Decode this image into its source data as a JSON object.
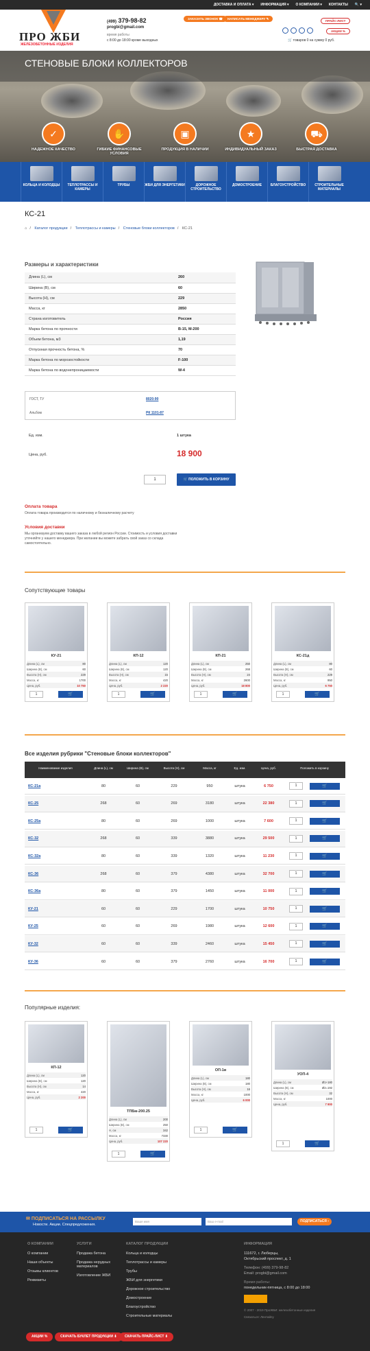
{
  "topnav": {
    "items": [
      "ДОСТАВКА И ОПЛАТА ▾",
      "ИНФОРМАЦИЯ ▾",
      "О КОМПАНИИ ▾",
      "КОНТАКТЫ",
      "🔍 ▾"
    ]
  },
  "header": {
    "logo_text": "ПРО ЖБИ",
    "logo_sub": "ЖЕЛЕЗОБЕТОННЫЕ ИЗДЕЛИЯ",
    "phone_prefix": "(499)",
    "phone": "379-98-82",
    "email": "progbi@gmail.com",
    "hours_label": "время работы",
    "hours": "с 8:00 до 18:00 кроме выходных",
    "btn_call": "ЗАКАЗАТЬ ЗВОНОК",
    "btn_manager": "НАПИСАТЬ МЕНЕДЖЕРУ",
    "btn_price": "ПРАЙС-ЛИСТ",
    "btn_stock": "АКЦИИ",
    "cart": "товаров 0 на сумму 0 руб."
  },
  "hero": {
    "title": "СТЕНОВЫЕ БЛОКИ КОЛЛЕКТОРОВ",
    "features": [
      "НАДЕЖНОЕ КАЧЕСТВО",
      "ГИБКИЕ ФИНАНСОВЫЕ УСЛОВИЯ",
      "ПРОДУКЦИЯ В НАЛИЧИИ",
      "ИНДИВИДУАЛЬНЫЙ ЗАКАЗ",
      "БЫСТРАЯ ДОСТАВКА"
    ]
  },
  "categories": [
    "КОЛЬЦА И КОЛОДЦЫ",
    "ТЕПЛОТРАССЫ И КАМЕРЫ",
    "ТРУБЫ",
    "ЖБИ ДЛЯ ЭНЕРГЕТИКИ",
    "ДОРОЖНОЕ СТРОИТЕЛЬСТВО",
    "ДОМОСТРОЕНИЕ",
    "БЛАГОУСТРОЙСТВО",
    "СТРОИТЕЛЬНЫЕ МАТЕРИАЛЫ"
  ],
  "product": {
    "title": "КС-21",
    "breadcrumbs": [
      "Каталог продукции",
      "Теплотрассы и камеры",
      "Стеновые блоки коллекторов",
      "КС-21"
    ],
    "specs_title": "Размеры и характеристики",
    "specs": [
      [
        "Длина (L), см",
        "260"
      ],
      [
        "Ширина (B), см",
        "60"
      ],
      [
        "Высота (H), см",
        "229"
      ],
      [
        "Масса, кг",
        "2850"
      ],
      [
        "Страна изготовитель",
        "Россия"
      ],
      [
        "Марка бетона по прочности",
        "В-15, М-200"
      ],
      [
        "Объем бетона, м3",
        "1,19"
      ],
      [
        "Отпускная прочность бетона, %",
        "70"
      ],
      [
        "Марка бетона по морозостойкости",
        "F-100"
      ],
      [
        "Марка бетона по водонепроницаемости",
        "W-4"
      ]
    ],
    "gost_label": "ГОСТ, ТУ",
    "gost_value": "8020-90",
    "album_label": "Альбом",
    "album_value": "РК 1101-87",
    "unit_label": "Ед. изм.",
    "unit_value": "1 штука",
    "price_label": "Цена, руб.",
    "price_value": "18 900",
    "qty": "1",
    "add_btn": "ПОЛОЖИТЬ В КОРЗИНУ"
  },
  "payment": {
    "title": "Оплата товара",
    "text": "Оплата товара производится по наличному и безналичному расчету",
    "delivery_title": "Условия доставки",
    "delivery_text1": "Мы организуем доставку вашего заказа в любой регион России. Стоимость и условия доставки",
    "delivery_text2": "уточняйте у нашего менеджера. При желании вы можете забрать свой заказ со склада",
    "delivery_text3": "самостоятельно."
  },
  "related": {
    "title": "Сопутствующие товары",
    "items": [
      {
        "name": "КУ-21",
        "rows": [
          [
            "Длина (L), см",
            "80"
          ],
          [
            "Ширина (B), см",
            "60"
          ],
          [
            "Высота (H), см",
            "229"
          ],
          [
            "Масса, кг",
            "1700"
          ],
          [
            "Цена, руб.",
            "10 750"
          ]
        ]
      },
      {
        "name": "КП-12",
        "rows": [
          [
            "Длина (L), см",
            "120"
          ],
          [
            "Ширина (B), см",
            "120"
          ],
          [
            "Высота (H), см",
            "15"
          ],
          [
            "Масса, кг",
            "420"
          ],
          [
            "Цена, руб.",
            "2 220"
          ]
        ]
      },
      {
        "name": "КП-21",
        "rows": [
          [
            "Длина (L), см",
            "250"
          ],
          [
            "Ширина (B), см",
            "268"
          ],
          [
            "Высота (H), см",
            "24"
          ],
          [
            "Масса, кг",
            "2600"
          ],
          [
            "Цена, руб.",
            "18 800"
          ]
        ]
      },
      {
        "name": "КС-21д",
        "rows": [
          [
            "Длина (L), см",
            "80"
          ],
          [
            "Ширина (B), см",
            "60"
          ],
          [
            "Высота (H), см",
            "229"
          ],
          [
            "Масса, кг",
            "950"
          ],
          [
            "Цена, руб.",
            "6 750"
          ]
        ]
      }
    ]
  },
  "list": {
    "title": "Все изделия рубрики \"Стеновые блоки коллекторов\"",
    "headers": [
      "Наименование изделия",
      "Длина (L), см",
      "Ширина (B), см",
      "Высота (H), см",
      "Масса, кг",
      "Ед. изм.",
      "Цена, руб.",
      "Положить в корзину"
    ],
    "rows": [
      [
        "КС-21а",
        "80",
        "60",
        "229",
        "950",
        "штука",
        "6 750"
      ],
      [
        "КС-25",
        "268",
        "60",
        "269",
        "3180",
        "штука",
        "22 380"
      ],
      [
        "КС-25а",
        "80",
        "60",
        "269",
        "1000",
        "штука",
        "7 600"
      ],
      [
        "КС-32",
        "268",
        "60",
        "339",
        "3880",
        "штука",
        "29 500"
      ],
      [
        "КС-32а",
        "80",
        "60",
        "339",
        "1320",
        "штука",
        "11 230"
      ],
      [
        "КС-36",
        "268",
        "60",
        "379",
        "4380",
        "штука",
        "32 700"
      ],
      [
        "КС-36а",
        "80",
        "60",
        "379",
        "1450",
        "штука",
        "11 000"
      ],
      [
        "КУ-21",
        "60",
        "60",
        "229",
        "1700",
        "штука",
        "10 750"
      ],
      [
        "КУ-25",
        "60",
        "60",
        "269",
        "1980",
        "штука",
        "12 600"
      ],
      [
        "КУ-32",
        "60",
        "60",
        "339",
        "2460",
        "штука",
        "15 450"
      ],
      [
        "КУ-36",
        "60",
        "60",
        "379",
        "2760",
        "штука",
        "16 700"
      ]
    ],
    "qty": "1"
  },
  "popular": {
    "title": "Популярные изделия:",
    "items": [
      {
        "name": "КП-12",
        "rows": [
          [
            "Длина (L), см",
            "120"
          ],
          [
            "Ширина (B), см",
            "120"
          ],
          [
            "Высота (H), см",
            "14"
          ],
          [
            "Масса, кг",
            "420"
          ],
          [
            "Цена, руб.",
            "2 200"
          ]
        ]
      },
      {
        "name": "ТПБм-200.25",
        "rows": [
          [
            "Длина (L), см",
            "200"
          ],
          [
            "Ширина (B), см",
            "250"
          ],
          [
            "H, см",
            "342"
          ],
          [
            "Масса, кг",
            "7330"
          ],
          [
            "Цена, руб.",
            "107 220"
          ]
        ]
      },
      {
        "name": "ОП-1в",
        "rows": [
          [
            "Длина (L), см",
            "180"
          ],
          [
            "Ширина (B), см",
            "180"
          ],
          [
            "Высота (H), см",
            "16"
          ],
          [
            "Масса, кг",
            "1000"
          ],
          [
            "Цена, руб.",
            "6 000"
          ]
        ]
      },
      {
        "name": "УОП-4",
        "rows": [
          [
            "Длина (L), см",
            "Ø1+180"
          ],
          [
            "Ширина (B), см",
            "Ø2=192"
          ],
          [
            "Высота (H), см",
            "32"
          ],
          [
            "Масса, кг",
            "1000"
          ],
          [
            "Цена, руб.",
            "7 900"
          ]
        ]
      }
    ]
  },
  "subscribe": {
    "title": "ПОДПИСАТЬСЯ НА РАССЫЛКУ",
    "subtitle": "Новости. Акции. Спецпредложения.",
    "name_ph": "Ваше имя",
    "email_ph": "Ваш e-mail",
    "btn": "ПОДПИСАТЬСЯ"
  },
  "footer": {
    "about_title": "О КОМПАНИИ",
    "about": [
      "О компании",
      "Наши объекты",
      "Отзывы клиентов",
      "Реквизиты"
    ],
    "services_title": "УСЛУГИ",
    "services": [
      "Продажа бетона",
      "Продажа нерудных материалов",
      "Изготовление ЖБИ"
    ],
    "catalog_title": "КАТАЛОГ ПРОДУКЦИИ",
    "catalog": [
      "Кольца и колодцы",
      "Теплотрассы и камеры",
      "Трубы",
      "ЖБИ для энергетики",
      "Дорожное строительство",
      "Домостроение",
      "Благоустройство",
      "Строительные материалы"
    ],
    "info_title": "ИНФОРМАЦИЯ",
    "address1": "111672, г. Люберцы,",
    "address2": "Октябрьский проспект, д. 1",
    "phone": "Телефон: (499) 379-98-82",
    "email": "Email: progbi@gmail.com",
    "hours_label": "Время работы:",
    "hours": "понедельник-пятница, с 8:00 до 18:00",
    "copyright": "© 2007 - 2019 ПроЖБИ: железобетонные изделия",
    "sitemap": "Связаться: Лентайпу",
    "pill_stock": "АКЦИИ",
    "pill_catalog": "СКАЧАТЬ БУКЛЕТ ПРОДУКЦИИ",
    "pill_price": "СКАЧАТЬ ПРАЙС-ЛИСТ"
  }
}
